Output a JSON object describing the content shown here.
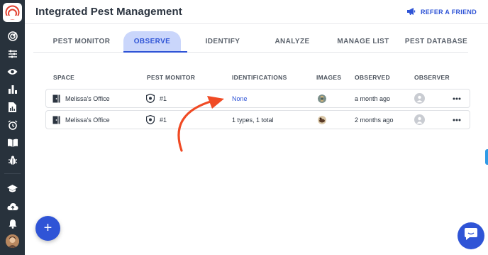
{
  "app": {
    "title": "Integrated Pest Management",
    "refer_label": "REFER A FRIEND"
  },
  "sidebar": {
    "items": [
      {
        "icon": "target-icon"
      },
      {
        "icon": "sliders-icon"
      },
      {
        "icon": "eye-icon"
      },
      {
        "icon": "bar-chart-icon"
      },
      {
        "icon": "report-icon"
      },
      {
        "icon": "alarm-clock-icon"
      },
      {
        "icon": "book-icon"
      },
      {
        "icon": "bug-icon"
      },
      {
        "icon": "graduation-cap-icon"
      },
      {
        "icon": "cloud-upload-icon"
      },
      {
        "icon": "bell-icon"
      }
    ]
  },
  "tabs": [
    {
      "label": "PEST MONITOR"
    },
    {
      "label": "OBSERVE",
      "active": true
    },
    {
      "label": "IDENTIFY"
    },
    {
      "label": "ANALYZE"
    },
    {
      "label": "MANAGE LIST"
    },
    {
      "label": "PEST DATABASE"
    }
  ],
  "table": {
    "headers": {
      "space": "SPACE",
      "pest_monitor": "PEST MONITOR",
      "identifications": "IDENTIFICATIONS",
      "images": "IMAGES",
      "observed": "OBSERVED",
      "observer": "OBSERVER"
    },
    "rows": [
      {
        "space": "Melissa's Office",
        "monitor": "#1",
        "identifications": "None",
        "observed": "a month ago"
      },
      {
        "space": "Melissa's Office",
        "monitor": "#1",
        "identifications": "1 types, 1 total",
        "observed": "2 months ago"
      }
    ]
  },
  "fab": {
    "label": "+"
  },
  "colors": {
    "accent": "#2f54d6",
    "sidebar": "#28323c",
    "active_tab_bg": "#cad6fb",
    "annotation_arrow": "#f04a24"
  }
}
